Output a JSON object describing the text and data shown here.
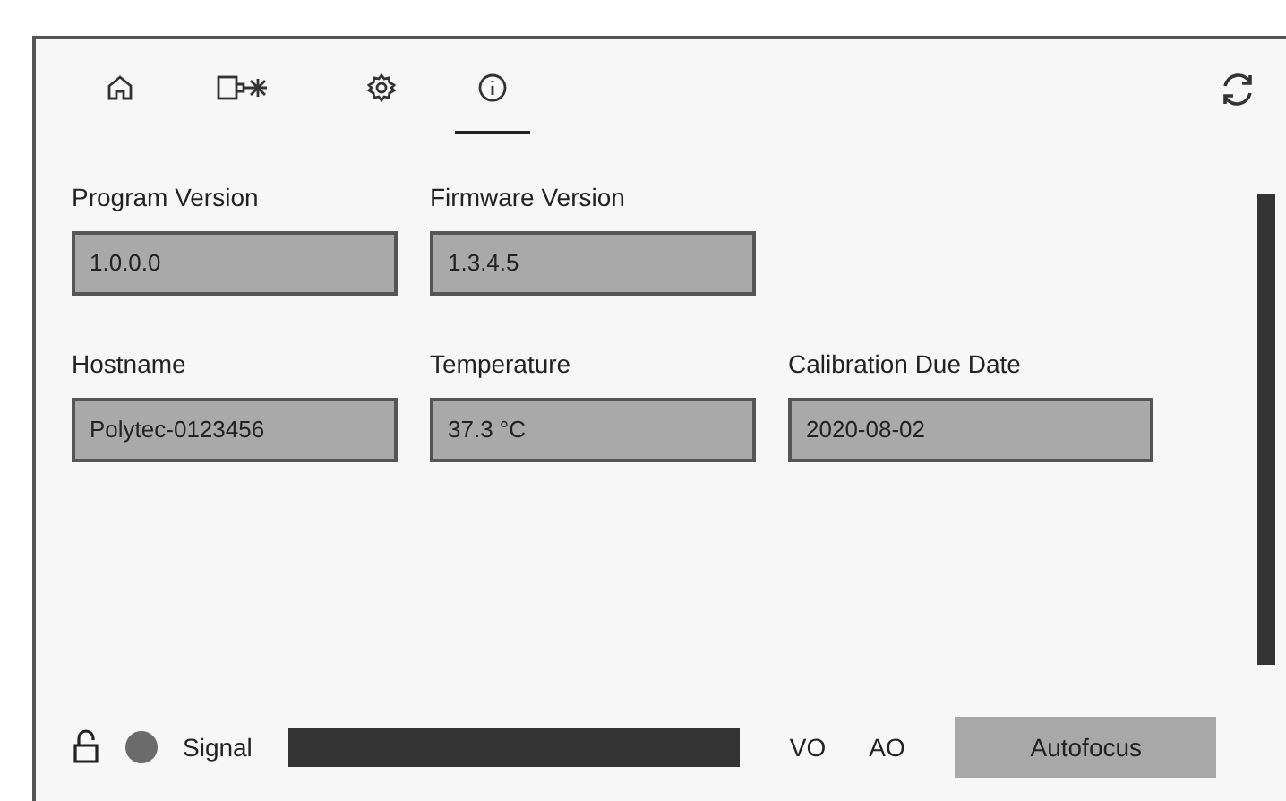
{
  "tabs": [
    {
      "kind": "home",
      "selected": false
    },
    {
      "kind": "laser",
      "selected": false
    },
    {
      "kind": "settings",
      "selected": false
    },
    {
      "kind": "info",
      "selected": true
    }
  ],
  "field_rows": [
    [
      {
        "label": "Program Version",
        "value": "1.0.0.0"
      },
      {
        "label": "Firmware Version",
        "value": "1.3.4.5"
      }
    ],
    [
      {
        "label": "Hostname",
        "value": "Polytec-0123456"
      },
      {
        "label": "Temperature",
        "value": "37.3 °C"
      },
      {
        "label": "Calibration Due Date",
        "value": "2020-08-02"
      }
    ]
  ],
  "status_bar": {
    "locked": false,
    "signal_label": "Signal",
    "level": 1,
    "indicators": [
      "VO",
      "AO"
    ],
    "button": "Autofocus"
  }
}
